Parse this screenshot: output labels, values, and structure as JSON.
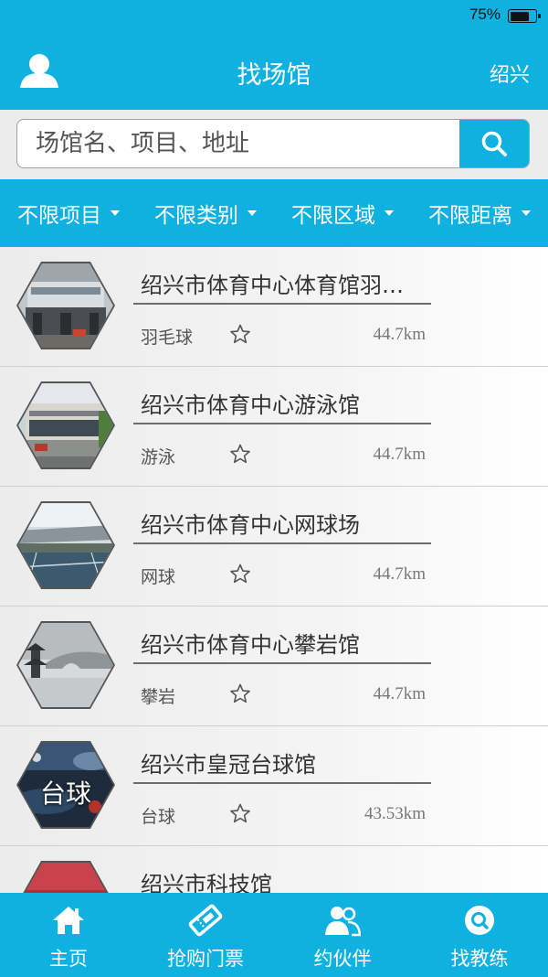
{
  "status_bar": {
    "battery_text": "75%",
    "battery_level": 0.75
  },
  "nav": {
    "title": "找场馆",
    "city": "绍兴",
    "user_icon": "user-icon"
  },
  "search": {
    "placeholder": "场馆名、项目、地址",
    "icon": "search-icon"
  },
  "filters": [
    {
      "label": "不限项目"
    },
    {
      "label": "不限类别"
    },
    {
      "label": "不限区域"
    },
    {
      "label": "不限距离"
    }
  ],
  "venues": [
    {
      "name": "绍兴市体育中心体育馆羽毛球馆",
      "sport": "羽毛球",
      "distance": "44.7km",
      "thumb_text": ""
    },
    {
      "name": "绍兴市体育中心游泳馆",
      "sport": "游泳",
      "distance": "44.7km",
      "thumb_text": ""
    },
    {
      "name": "绍兴市体育中心网球场",
      "sport": "网球",
      "distance": "44.7km",
      "thumb_text": ""
    },
    {
      "name": "绍兴市体育中心攀岩馆",
      "sport": "攀岩",
      "distance": "44.7km",
      "thumb_text": ""
    },
    {
      "name": "绍兴市皇冠台球馆",
      "sport": "台球",
      "distance": "43.53km",
      "thumb_text": "台球"
    },
    {
      "name": "绍兴市科技馆",
      "sport": "",
      "distance": "",
      "thumb_text": ""
    }
  ],
  "tabs": [
    {
      "label": "主页",
      "icon": "home-icon"
    },
    {
      "label": "抢购门票",
      "icon": "ticket-icon"
    },
    {
      "label": "约伙伴",
      "icon": "partners-icon"
    },
    {
      "label": "找教练",
      "icon": "find-coach-icon"
    }
  ],
  "colors": {
    "primary": "#0fb1e1",
    "background": "#ececec",
    "text": "#333333"
  }
}
